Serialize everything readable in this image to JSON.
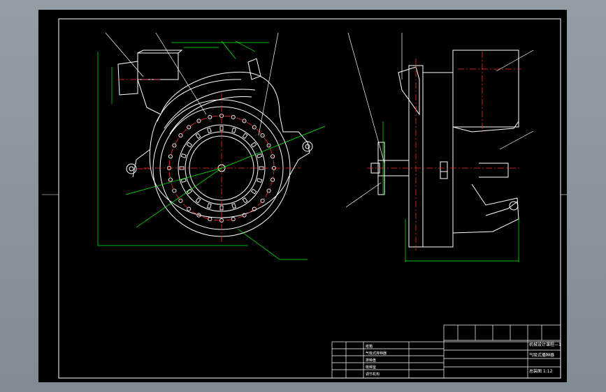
{
  "title_block": {
    "drawing_title": "机械设计课程—1",
    "drawing_subtitle": "气吸式播种器",
    "drawing_no": "总装图 1:12"
  },
  "bom": {
    "rows": [
      "纸箱",
      "气吸式排种器",
      "排种盘",
      "吸种室",
      "调节机构"
    ]
  },
  "colors": {
    "outline": "#ffffff",
    "dimension": "#00ff00",
    "centerline": "#ff2a2a",
    "background": "#000000",
    "frame": "#ffffff"
  }
}
